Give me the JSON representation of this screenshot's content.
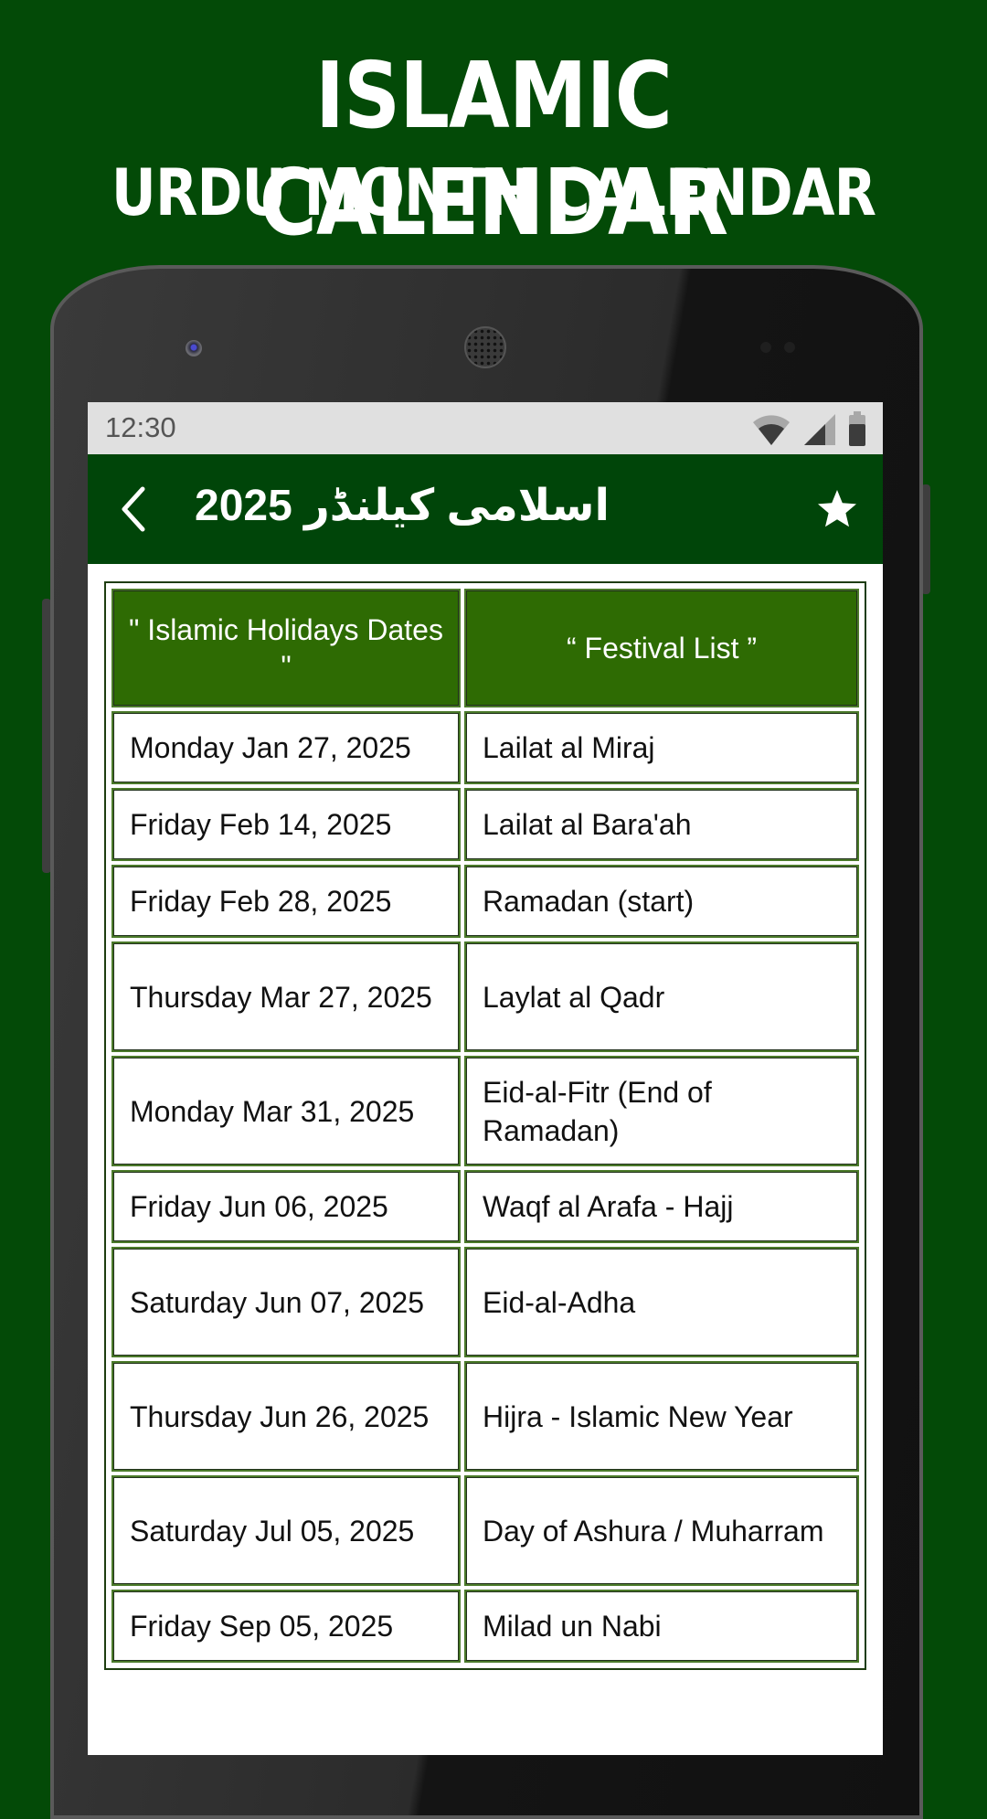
{
  "promo": {
    "title_line1": "ISLAMIC CALENDAR",
    "title_line2": "URDU MONTH CALENDAR"
  },
  "status_bar": {
    "time": "12:30",
    "icons": [
      "wifi-icon",
      "cell-signal-icon",
      "battery-icon"
    ]
  },
  "toolbar": {
    "back_icon": "chevron-left-icon",
    "title": "اسلامی کیلنڈر 2025",
    "star_icon": "star-icon"
  },
  "colors": {
    "background": "#034a07",
    "toolbar": "#004509",
    "table_header": "#2e6b03",
    "status_bar": "#e0e0e0"
  },
  "table": {
    "headers": [
      "\" Islamic Holidays Dates \"",
      "“ Festival List ”"
    ],
    "rows": [
      {
        "date": "Monday Jan 27, 2025",
        "festival": "Lailat al Miraj"
      },
      {
        "date": "Friday Feb 14, 2025",
        "festival": "Lailat al Bara'ah"
      },
      {
        "date": "Friday Feb 28, 2025",
        "festival": "Ramadan (start)"
      },
      {
        "date": "Thursday Mar 27, 2025",
        "festival": "Laylat al Qadr"
      },
      {
        "date": "Monday Mar 31, 2025",
        "festival": "Eid-al-Fitr (End of Ramadan)"
      },
      {
        "date": "Friday Jun 06, 2025",
        "festival": "Waqf al Arafa - Hajj"
      },
      {
        "date": "Saturday Jun 07, 2025",
        "festival": "Eid-al-Adha"
      },
      {
        "date": "Thursday Jun 26, 2025",
        "festival": "Hijra - Islamic New Year"
      },
      {
        "date": "Saturday Jul 05, 2025",
        "festival": "Day of Ashura / Muharram"
      },
      {
        "date": "Friday Sep 05, 2025",
        "festival": "Milad un Nabi"
      }
    ]
  }
}
